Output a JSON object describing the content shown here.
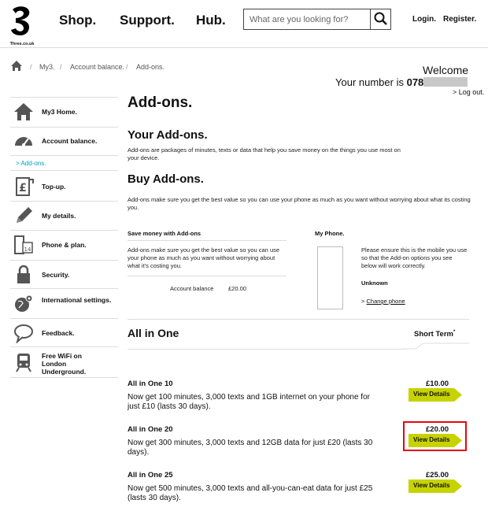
{
  "header": {
    "logo_text": "Three.co.uk",
    "nav": [
      "Shop.",
      "Support.",
      "Hub."
    ],
    "search_placeholder": "What are you looking for?",
    "login": "Login.",
    "register": "Register."
  },
  "breadcrumb": [
    "My3.",
    "Account balance.",
    "Add-ons."
  ],
  "account": {
    "welcome": "Welcome",
    "number_label": "Your number is",
    "number_prefix": "078",
    "logout": "> Log out."
  },
  "sidebar": {
    "items": [
      {
        "label": "My3 Home.",
        "icon": "home-icon"
      },
      {
        "label": "Account balance.",
        "icon": "gauge-icon"
      },
      {
        "label": "> Add-ons.",
        "icon": ""
      },
      {
        "label": "Top-up.",
        "icon": "pound-topup-icon"
      },
      {
        "label": "My details.",
        "icon": "pencil-icon"
      },
      {
        "label": "Phone & plan.",
        "icon": "phone-calendar-icon"
      },
      {
        "label": "Security.",
        "icon": "lock-icon"
      },
      {
        "label": "International settings.",
        "icon": "globe-gear-icon"
      },
      {
        "label": "Feedback.",
        "icon": "speech-bubble-icon"
      },
      {
        "label": "Free WiFi on London Underground.",
        "icon": "train-icon"
      }
    ]
  },
  "main": {
    "title": "Add-ons.",
    "your_addons_heading": "Your Add-ons.",
    "your_addons_text": "Add-ons are packages of minutes, texts or data that help you save money on the things you use most on your device.",
    "buy_heading": "Buy Add-ons.",
    "buy_text": "Add-ons make sure you get the best value so you can use your phone as much as you want without worrying about what its costing you.",
    "save_heading": "Save money with Add-ons",
    "save_text": "Add-ons make sure you get the best value so you can use your phone as much as you want without worrying about what it's costing you.",
    "account_balance_label": "Account balance",
    "account_balance_value": "£20.00",
    "my_phone_heading": "My Phone.",
    "my_phone_text": "Please ensure this is the mobile you use so that the Add-on options you see below will work correctly.",
    "phone_model": "Unknown",
    "change_phone_prefix": ">",
    "change_phone_link": "Change phone"
  },
  "section": {
    "title": "All in One",
    "tab_label": "Short Term",
    "tab_marker": "*"
  },
  "offers": [
    {
      "name": "All in One 10",
      "description": "Now get 100 minutes, 3,000 texts and 1GB internet on your phone for just £10 (lasts 30 days).",
      "price": "£10.00",
      "button": "View Details",
      "highlighted": false
    },
    {
      "name": "All in One 20",
      "description": "Now get 300 minutes, 3,000 texts and 12GB data for just £20 (lasts 30 days).",
      "price": "£20.00",
      "button": "View Details",
      "highlighted": true
    },
    {
      "name": "All in One 25",
      "description": "Now get 500 minutes, 3,000 texts and all-you-can-eat data for just £25 (lasts 30 days).",
      "price": "£25.00",
      "button": "View Details",
      "highlighted": false
    }
  ],
  "colors": {
    "button_green": "#c7d300",
    "highlight_red": "#e30613",
    "sidebar_link": "#00a0c6"
  }
}
